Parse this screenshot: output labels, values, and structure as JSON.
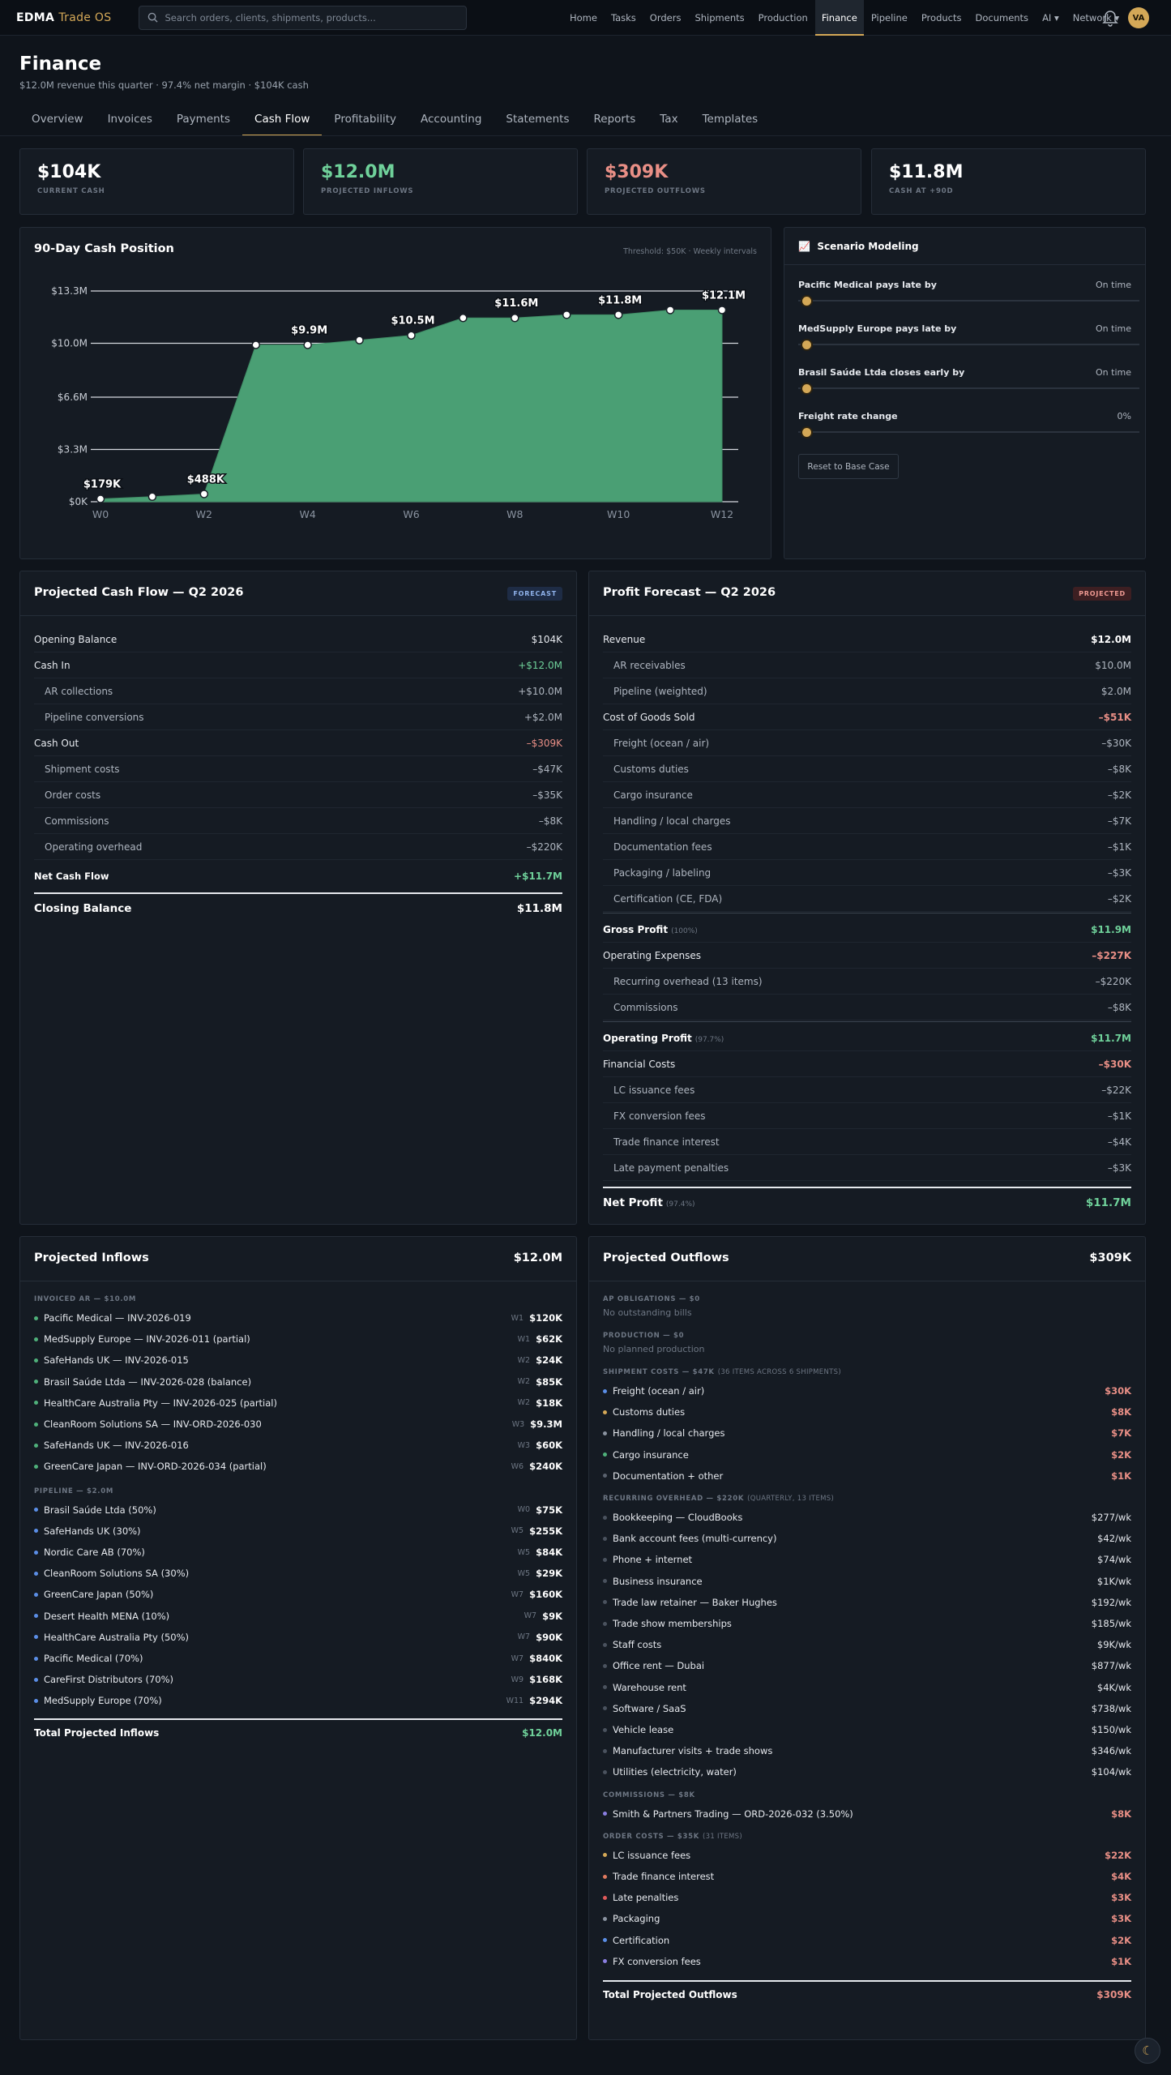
{
  "app": {
    "brand": "EDMA",
    "brand_accent": "Trade OS",
    "avatar": "VA"
  },
  "search": {
    "placeholder": "Search orders, clients, shipments, products..."
  },
  "nav": [
    {
      "label": "Home"
    },
    {
      "label": "Tasks"
    },
    {
      "label": "Orders"
    },
    {
      "label": "Shipments"
    },
    {
      "label": "Production"
    },
    {
      "label": "Finance",
      "active": true
    },
    {
      "label": "Pipeline"
    },
    {
      "label": "Products"
    },
    {
      "label": "Documents"
    },
    {
      "label": "AI ▾"
    },
    {
      "label": "Network ▾"
    }
  ],
  "page": {
    "title": "Finance",
    "subtitle": "$12.0M revenue this quarter · 97.4% net margin · $104K cash"
  },
  "tabs": [
    "Overview",
    "Invoices",
    "Payments",
    "Cash Flow",
    "Profitability",
    "Accounting",
    "Statements",
    "Reports",
    "Tax",
    "Templates"
  ],
  "kpis": [
    {
      "value": "$104K",
      "label": "CURRENT CASH"
    },
    {
      "value": "$12.0M",
      "label": "PROJECTED INFLOWS"
    },
    {
      "value": "$309K",
      "label": "PROJECTED OUTFLOWS"
    },
    {
      "value": "$11.8M",
      "label": "CASH AT +90D"
    }
  ],
  "chart_panel": {
    "title": "90-Day Cash Position",
    "subtitle": "Threshold: $50K · Weekly intervals"
  },
  "chart_data": {
    "type": "area",
    "x": [
      0,
      1,
      2,
      3,
      4,
      5,
      6,
      7,
      8,
      9,
      10,
      11,
      12
    ],
    "x_tick_labels": [
      "W0",
      "W2",
      "W4",
      "W6",
      "W8",
      "W10",
      "W12"
    ],
    "x_tick_values": [
      0,
      2,
      4,
      6,
      8,
      10,
      12
    ],
    "y_tick_labels": [
      "$0K",
      "$3.3M",
      "$6.6M",
      "$10.0M",
      "$13.3M"
    ],
    "y_tick_values": [
      0,
      3.3,
      6.6,
      10.0,
      13.3
    ],
    "ylim": [
      0,
      13.3
    ],
    "series": [
      {
        "values": [
          0.179,
          0.32,
          0.488,
          9.9,
          9.9,
          10.2,
          10.5,
          11.6,
          11.6,
          11.8,
          11.8,
          12.1,
          12.1
        ]
      }
    ],
    "data_labels": [
      {
        "x": 0,
        "y": 0.179,
        "text": "$179K"
      },
      {
        "x": 2,
        "y": 0.488,
        "text": "$488K"
      },
      {
        "x": 4,
        "y": 9.9,
        "text": "$9.9M"
      },
      {
        "x": 6,
        "y": 10.5,
        "text": "$10.5M"
      },
      {
        "x": 8,
        "y": 11.6,
        "text": "$11.6M"
      },
      {
        "x": 10,
        "y": 11.8,
        "text": "$11.8M"
      },
      {
        "x": 12,
        "y": 12.1,
        "text": "$12.1M"
      }
    ],
    "fill_color": "#4a9f74",
    "grid": true
  },
  "scenario": {
    "title": "Scenario Modeling",
    "items": [
      {
        "label": "Pacific Medical pays late by",
        "value": "On time",
        "level": 0
      },
      {
        "label": "MedSupply Europe pays late by",
        "value": "On time",
        "level": 0
      },
      {
        "label": "Brasil Saúde Ltda closes early by",
        "value": "On time",
        "level": 0
      },
      {
        "label": "Freight rate change",
        "value": "0%",
        "level": 0
      }
    ],
    "reset_label": "Reset to Base Case"
  },
  "cashflow": {
    "title": "Projected Cash Flow — Q2 2026",
    "badge": "FORECAST",
    "rows": [
      {
        "label": "Opening Balance",
        "amount": "$104K",
        "kind": "head"
      },
      {
        "label": "Cash In",
        "amount": "+$12.0M",
        "kind": "head",
        "tone": "pos"
      },
      {
        "label": "AR collections",
        "amount": "+$10.0M",
        "kind": "sub"
      },
      {
        "label": "Pipeline conversions",
        "amount": "+$2.0M",
        "kind": "sub"
      },
      {
        "label": "Cash Out",
        "amount": "–$309K",
        "kind": "head",
        "tone": "neg"
      },
      {
        "label": "Shipment costs",
        "amount": "–$47K",
        "kind": "sub"
      },
      {
        "label": "Order costs",
        "amount": "–$35K",
        "kind": "sub"
      },
      {
        "label": "Commissions",
        "amount": "–$8K",
        "kind": "sub"
      },
      {
        "label": "Operating overhead",
        "amount": "–$220K",
        "kind": "sub"
      }
    ],
    "net_label": "Net Cash Flow",
    "net_amount": "+$11.7M",
    "closing_label": "Closing Balance",
    "closing_amount": "$11.8M"
  },
  "profit": {
    "title": "Profit Forecast — Q2 2026",
    "badge": "PROJECTED",
    "rows": [
      {
        "label": "Revenue",
        "amount": "$12.0M",
        "kind": "head"
      },
      {
        "label": "AR receivables",
        "amount": "$10.0M",
        "kind": "sub"
      },
      {
        "label": "Pipeline (weighted)",
        "amount": "$2.0M",
        "kind": "sub"
      },
      {
        "label": "Cost of Goods Sold",
        "amount": "–$51K",
        "kind": "head",
        "tone": "neg"
      },
      {
        "label": "Freight (ocean / air)",
        "amount": "–$30K",
        "kind": "sub"
      },
      {
        "label": "Customs duties",
        "amount": "–$8K",
        "kind": "sub"
      },
      {
        "label": "Cargo insurance",
        "amount": "–$2K",
        "kind": "sub"
      },
      {
        "label": "Handling / local charges",
        "amount": "–$7K",
        "kind": "sub"
      },
      {
        "label": "Documentation fees",
        "amount": "–$1K",
        "kind": "sub"
      },
      {
        "label": "Packaging / labeling",
        "amount": "–$3K",
        "kind": "sub"
      },
      {
        "label": "Certification (CE, FDA)",
        "amount": "–$2K",
        "kind": "sub"
      },
      {
        "label": "Gross Profit",
        "pct": "(100%)",
        "amount": "$11.9M",
        "kind": "bold",
        "tone": "pos"
      },
      {
        "label": "Operating Expenses",
        "amount": "–$227K",
        "kind": "head",
        "tone": "neg"
      },
      {
        "label": "Recurring overhead (13 items)",
        "amount": "–$220K",
        "kind": "sub"
      },
      {
        "label": "Commissions",
        "amount": "–$8K",
        "kind": "sub"
      },
      {
        "label": "Operating Profit",
        "pct": "(97.7%)",
        "amount": "$11.7M",
        "kind": "bold",
        "tone": "pos"
      },
      {
        "label": "Financial Costs",
        "amount": "–$30K",
        "kind": "head",
        "tone": "neg"
      },
      {
        "label": "LC issuance fees",
        "amount": "–$22K",
        "kind": "sub"
      },
      {
        "label": "FX conversion fees",
        "amount": "–$1K",
        "kind": "sub"
      },
      {
        "label": "Trade finance interest",
        "amount": "–$4K",
        "kind": "sub"
      },
      {
        "label": "Late payment penalties",
        "amount": "–$3K",
        "kind": "sub"
      }
    ],
    "net_label": "Net Profit",
    "net_pct": "(97.4%)",
    "net_amount": "$11.7M"
  },
  "inflows": {
    "title": "Projected Inflows",
    "total": "$12.0M",
    "groups": [
      {
        "title": "INVOICED AR — $10.0M",
        "color": "#4fb07a",
        "items": [
          {
            "label": "Pacific Medical — INV-2026-019",
            "week": "W1",
            "amount": "$120K"
          },
          {
            "label": "MedSupply Europe — INV-2026-011 (partial)",
            "week": "W1",
            "amount": "$62K"
          },
          {
            "label": "SafeHands UK — INV-2026-015",
            "week": "W2",
            "amount": "$24K"
          },
          {
            "label": "Brasil Saúde Ltda — INV-2026-028 (balance)",
            "week": "W2",
            "amount": "$85K"
          },
          {
            "label": "HealthCare Australia Pty — INV-2026-025 (partial)",
            "week": "W2",
            "amount": "$18K"
          },
          {
            "label": "CleanRoom Solutions SA — INV-ORD-2026-030",
            "week": "W3",
            "amount": "$9.3M"
          },
          {
            "label": "SafeHands UK — INV-2026-016",
            "week": "W3",
            "amount": "$60K"
          },
          {
            "label": "GreenCare Japan — INV-ORD-2026-034 (partial)",
            "week": "W6",
            "amount": "$240K"
          }
        ]
      },
      {
        "title": "PIPELINE — $2.0M",
        "color": "#5b8ee6",
        "items": [
          {
            "label": "Brasil Saúde Ltda (50%)",
            "week": "W0",
            "amount": "$75K"
          },
          {
            "label": "SafeHands UK (30%)",
            "week": "W5",
            "amount": "$255K"
          },
          {
            "label": "Nordic Care AB (70%)",
            "week": "W5",
            "amount": "$84K"
          },
          {
            "label": "CleanRoom Solutions SA (30%)",
            "week": "W5",
            "amount": "$29K"
          },
          {
            "label": "GreenCare Japan (50%)",
            "week": "W7",
            "amount": "$160K"
          },
          {
            "label": "Desert Health MENA (10%)",
            "week": "W7",
            "amount": "$9K"
          },
          {
            "label": "HealthCare Australia Pty (50%)",
            "week": "W7",
            "amount": "$90K"
          },
          {
            "label": "Pacific Medical (70%)",
            "week": "W7",
            "amount": "$840K"
          },
          {
            "label": "CareFirst Distributors (70%)",
            "week": "W9",
            "amount": "$168K"
          },
          {
            "label": "MedSupply Europe (70%)",
            "week": "W11",
            "amount": "$294K"
          }
        ]
      }
    ],
    "total_label": "Total Projected Inflows",
    "total_amount": "$12.0M"
  },
  "outflows": {
    "title": "Projected Outflows",
    "total": "$309K",
    "ap_title": "AP OBLIGATIONS — $0",
    "ap_empty": "No outstanding bills",
    "prod_title": "PRODUCTION — $0",
    "prod_empty": "No planned production",
    "ship_title": "SHIPMENT COSTS — $47K",
    "ship_note": "(36 ITEMS ACROSS 6 SHIPMENTS)",
    "ship_items": [
      {
        "label": "Freight (ocean / air)",
        "amount": "$30K",
        "color": "#5b8ee6"
      },
      {
        "label": "Customs duties",
        "amount": "$8K",
        "color": "#d4a857"
      },
      {
        "label": "Handling / local charges",
        "amount": "$7K",
        "color": "#8a93a0"
      },
      {
        "label": "Cargo insurance",
        "amount": "$2K",
        "color": "#4fb07a"
      },
      {
        "label": "Documentation + other",
        "amount": "$1K",
        "color": "#5a626e"
      }
    ],
    "oh_title": "RECURRING OVERHEAD — $220K",
    "oh_note": "(QUARTERLY, 13 ITEMS)",
    "oh_items": [
      {
        "label": "Bookkeeping — CloudBooks",
        "amount": "$277/wk"
      },
      {
        "label": "Bank account fees (multi-currency)",
        "amount": "$42/wk"
      },
      {
        "label": "Phone + internet",
        "amount": "$74/wk"
      },
      {
        "label": "Business insurance",
        "amount": "$1K/wk"
      },
      {
        "label": "Trade law retainer — Baker Hughes",
        "amount": "$192/wk"
      },
      {
        "label": "Trade show memberships",
        "amount": "$185/wk"
      },
      {
        "label": "Staff costs",
        "amount": "$9K/wk"
      },
      {
        "label": "Office rent — Dubai",
        "amount": "$877/wk"
      },
      {
        "label": "Warehouse rent",
        "amount": "$4K/wk"
      },
      {
        "label": "Software / SaaS",
        "amount": "$738/wk"
      },
      {
        "label": "Vehicle lease",
        "amount": "$150/wk"
      },
      {
        "label": "Manufacturer visits + trade shows",
        "amount": "$346/wk"
      },
      {
        "label": "Utilities (electricity, water)",
        "amount": "$104/wk"
      }
    ],
    "comm_title": "COMMISSIONS — $8K",
    "comm_items": [
      {
        "label": "Smith & Partners Trading — ORD-2026-032 (3.50%)",
        "amount": "$8K",
        "color": "#8a7ee0"
      }
    ],
    "oc_title": "ORDER COSTS — $35K",
    "oc_note": "(31 ITEMS)",
    "oc_items": [
      {
        "label": "LC issuance fees",
        "amount": "$22K",
        "color": "#d4a857"
      },
      {
        "label": "Trade finance interest",
        "amount": "$4K",
        "color": "#e07a5f"
      },
      {
        "label": "Late penalties",
        "amount": "$3K",
        "color": "#e05a5a"
      },
      {
        "label": "Packaging",
        "amount": "$3K",
        "color": "#8a93a0"
      },
      {
        "label": "Certification",
        "amount": "$2K",
        "color": "#5b8ee6"
      },
      {
        "label": "FX conversion fees",
        "amount": "$1K",
        "color": "#8a7ee0"
      }
    ],
    "total_label": "Total Projected Outflows",
    "total_amount": "$309K"
  },
  "colors": {
    "accent": "#d4a857",
    "positive": "#6fd19a",
    "negative": "#e98f86",
    "chart_fill": "#4a9f74"
  }
}
